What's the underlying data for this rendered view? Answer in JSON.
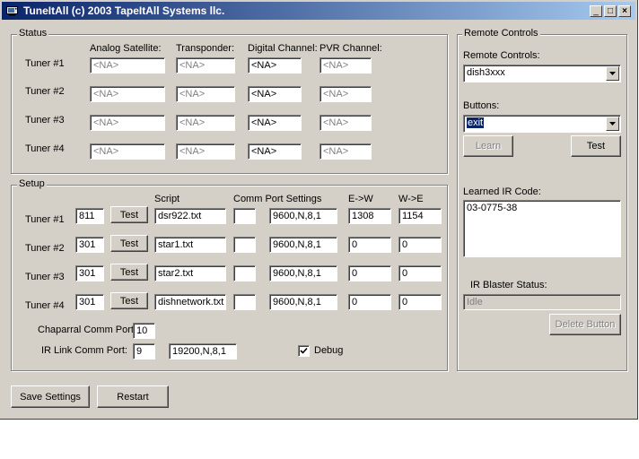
{
  "window": {
    "title": "TuneItAll (c) 2003 TapeItAll Systems llc."
  },
  "caption_buttons": {
    "minimize": "_",
    "maximize": "□",
    "close": "×"
  },
  "status": {
    "group_label": "Status",
    "columns": [
      "Analog Satellite:",
      "Transponder:",
      "Digital Channel:",
      "PVR Channel:"
    ],
    "tuners": [
      {
        "label": "Tuner #1",
        "values": [
          "<NA>",
          "<NA>",
          "<NA>",
          "<NA>"
        ]
      },
      {
        "label": "Tuner #2",
        "values": [
          "<NA>",
          "<NA>",
          "<NA>",
          "<NA>"
        ]
      },
      {
        "label": "Tuner #3",
        "values": [
          "<NA>",
          "<NA>",
          "<NA>",
          "<NA>"
        ]
      },
      {
        "label": "Tuner #4",
        "values": [
          "<NA>",
          "<NA>",
          "<NA>",
          "<NA>"
        ]
      }
    ]
  },
  "setup": {
    "group_label": "Setup",
    "headers": {
      "script": "Script",
      "comm": "Comm Port Settings",
      "ew": "E->W",
      "we": "W->E"
    },
    "test_label": "Test",
    "tuners": [
      {
        "label": "Tuner #1",
        "num": "811",
        "script": "dsr922.txt",
        "port": "",
        "comm": "9600,N,8,1",
        "ew": "1308",
        "we": "1154"
      },
      {
        "label": "Tuner #2",
        "num": "301",
        "script": "star1.txt",
        "port": "",
        "comm": "9600,N,8,1",
        "ew": "0",
        "we": "0"
      },
      {
        "label": "Tuner #3",
        "num": "301",
        "script": "star2.txt",
        "port": "",
        "comm": "9600,N,8,1",
        "ew": "0",
        "we": "0"
      },
      {
        "label": "Tuner #4",
        "num": "301",
        "script": "dishnetwork.txt",
        "port": "",
        "comm": "9600,N,8,1",
        "ew": "0",
        "we": "0"
      }
    ],
    "chaparral_label": "Chaparral Comm Port:",
    "chaparral_value": "10",
    "irlink_label": "IR Link Comm Port:",
    "irlink_port": "9",
    "irlink_settings": "19200,N,8,1",
    "debug_label": "Debug",
    "debug_checked": true
  },
  "remote": {
    "group_label": "Remote Controls",
    "remotes_label": "Remote Controls:",
    "remotes_value": "dish3xxx",
    "buttons_label": "Buttons:",
    "buttons_value": "exit",
    "learn_label": "Learn",
    "test_label": "Test",
    "learned_label": "Learned IR Code:",
    "learned_value": "03-0775-38",
    "blaster_label": "IR Blaster Status:",
    "blaster_value": "Idle",
    "delete_label": "Delete Button"
  },
  "footer": {
    "save_label": "Save Settings",
    "restart_label": "Restart"
  },
  "icons": {
    "app": "tv-icon",
    "dropdown": "chevron-down-icon",
    "check": "checkmark-icon"
  }
}
